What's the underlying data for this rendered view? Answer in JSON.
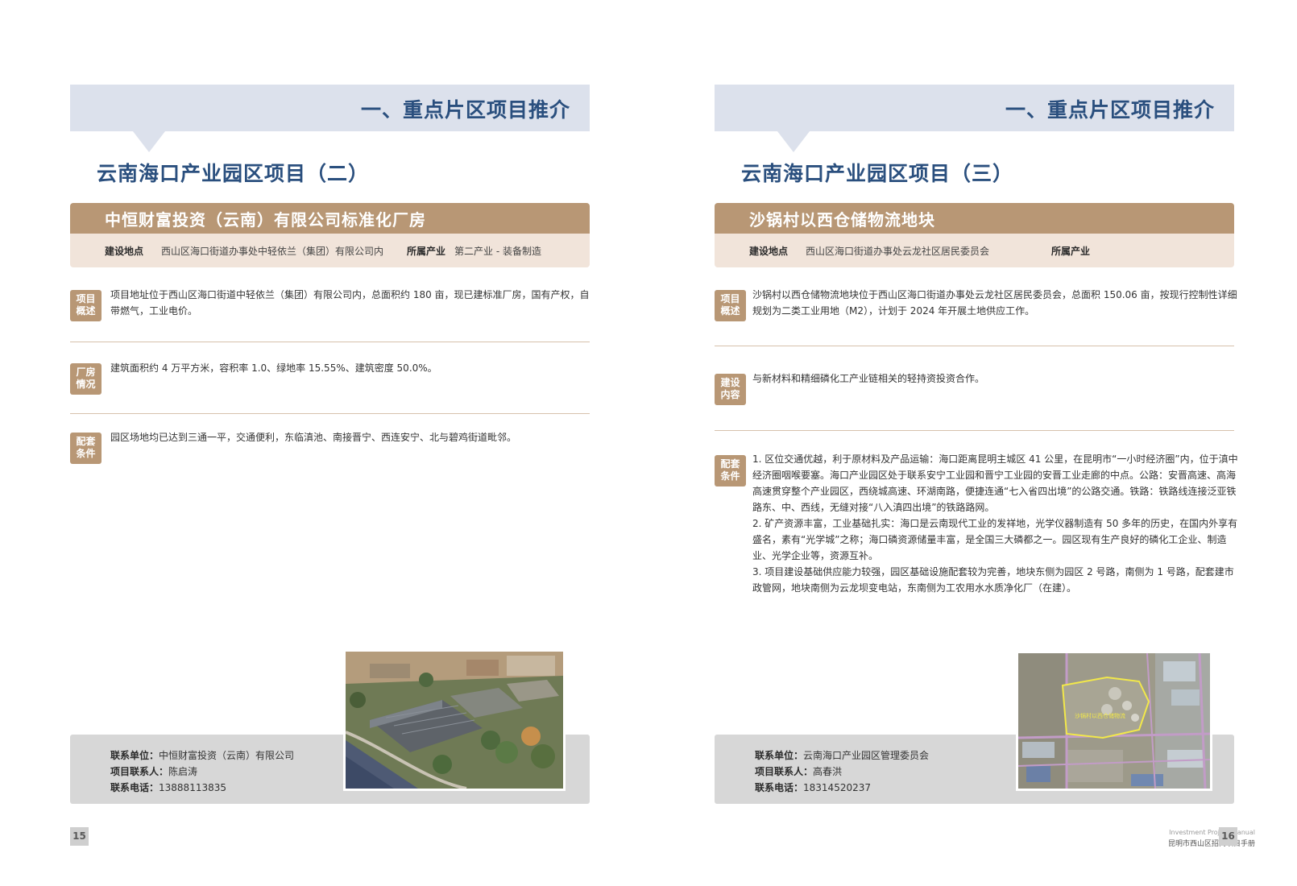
{
  "left": {
    "banner_title": "一、重点片区项目推介",
    "project_title": "云南海口产业园区项目（二）",
    "company_name": "中恒财富投资（云南）有限公司标准化厂房",
    "location_label": "建设地点",
    "location_value": "西山区海口街道办事处中轻依兰（集团）有限公司内",
    "industry_label": "所属产业",
    "industry_value": "第二产业 - 装备制造",
    "sections": [
      {
        "badge_1": "项目",
        "badge_2": "概述",
        "text": "项目地址位于西山区海口街道中轻依兰（集团）有限公司内，总面积约 180 亩，现已建标准厂房，国有产权，自带燃气，工业电价。"
      },
      {
        "badge_1": "厂房",
        "badge_2": "情况",
        "text": "建筑面积约 4 万平方米，容积率 1.0、绿地率 15.55%、建筑密度 50.0%。"
      },
      {
        "badge_1": "配套",
        "badge_2": "条件",
        "text": "园区场地均已达到三通一平，交通便利，东临滇池、南接晋宁、西连安宁、北与碧鸡街道毗邻。"
      }
    ],
    "contact": {
      "unit_label": "联系单位：",
      "unit_value": "中恒财富投资（云南）有限公司",
      "person_label": "项目联系人：",
      "person_value": "陈启涛",
      "phone_label": "联系电话：",
      "phone_value": "13888113835"
    },
    "page_number": "15"
  },
  "right": {
    "banner_title": "一、重点片区项目推介",
    "project_title": "云南海口产业园区项目（三）",
    "company_name": "沙锅村以西仓储物流地块",
    "location_label": "建设地点",
    "location_value": "西山区海口街道办事处云龙社区居民委员会",
    "industry_label": "所属产业",
    "industry_value": "",
    "sections": [
      {
        "badge_1": "项目",
        "badge_2": "概述",
        "text": "沙锅村以西仓储物流地块位于西山区海口街道办事处云龙社区居民委员会，总面积 150.06 亩，按现行控制性详细规划为二类工业用地（M2），计划于 2024 年开展土地供应工作。"
      },
      {
        "badge_1": "建设",
        "badge_2": "内容",
        "text": "与新材料和精细磷化工产业链相关的轻持资投资合作。"
      }
    ],
    "conditions": {
      "badge_1": "配套",
      "badge_2": "条件",
      "items": [
        "1. 区位交通优越，利于原材料及产品运输：海口距离昆明主城区 41 公里，在昆明市“一小时经济圈”内，位于滇中经济圈咽喉要塞。海口产业园区处于联系安宁工业园和晋宁工业园的安晋工业走廊的中点。公路：安晋高速、高海高速贯穿整个产业园区，西绕城高速、环湖南路，便捷连通“七入省四出境”的公路交通。铁路：铁路线连接泛亚铁路东、中、西线，无缝对接“八入滇四出境”的铁路路网。",
        "2. 矿产资源丰富，工业基础扎实：海口是云南现代工业的发祥地，光学仪器制造有 50 多年的历史，在国内外享有盛名，素有“光学城”之称；海口磷资源储量丰富，是全国三大磷都之一。园区现有生产良好的磷化工企业、制造业、光学企业等，资源互补。",
        "3. 项目建设基础供应能力较强，园区基础设施配套较为完善，地块东侧为园区 2 号路，南侧为 1 号路，配套建市政管网，地块南侧为云龙坝变电站，东南侧为工农用水水质净化厂（在建）。"
      ]
    },
    "contact": {
      "unit_label": "联系单位：",
      "unit_value": "云南海口产业园区管理委员会",
      "person_label": "项目联系人：",
      "person_value": "高春洪",
      "phone_label": "联系电话：",
      "phone_value": "18314520237"
    },
    "map_label": "沙锅村以西仓储物流",
    "page_number": "16",
    "footer_en": "Investment Project Manual",
    "footer_cn": "昆明市西山区招商项目手册"
  },
  "colors": {
    "banner_bg": "#dce1ec",
    "title_blue": "#2a4f7e",
    "accent_brown": "#b89775",
    "info_bg": "#f1e4da",
    "contact_bg": "#d7d7d7"
  }
}
